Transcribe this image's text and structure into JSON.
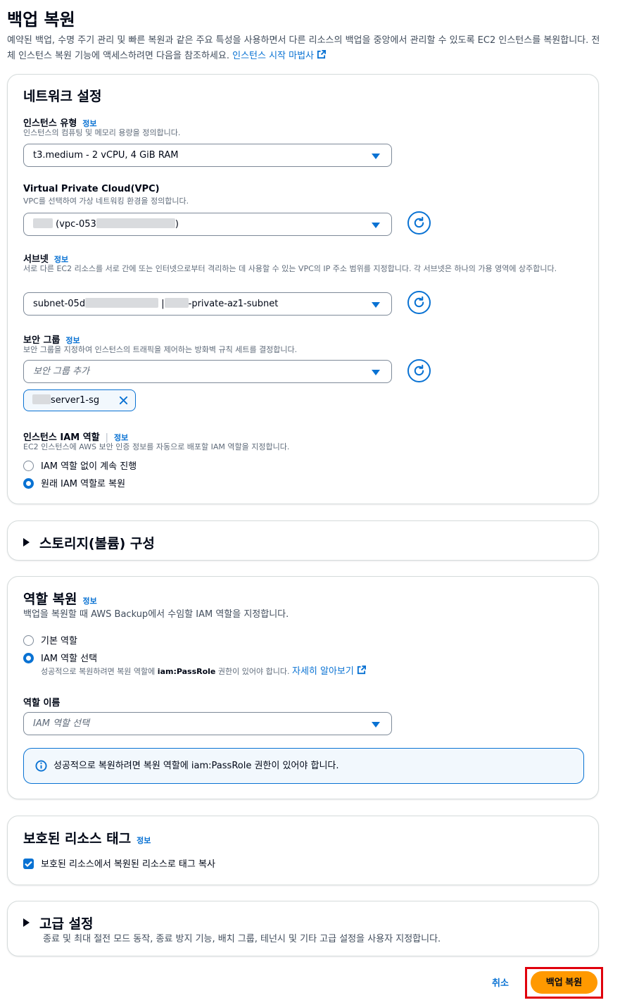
{
  "page": {
    "title": "백업 복원",
    "description": "예약된 백업, 수명 주기 관리 및 빠른 복원과 같은 주요 특성을 사용하면서 다른 리소스의 백업을 중앙에서 관리할 수 있도록 EC2 인스턴스를 복원합니다. 전체 인스턴스 복원 기능에 액세스하려면 다음을 참조하세요.",
    "description_link": "인스턴스 시작 마법사"
  },
  "network": {
    "heading": "네트워크 설정",
    "info": "정보",
    "instance_type": {
      "label": "인스턴스 유형",
      "desc": "인스턴스의 컴퓨팅 및 메모리 용량을 정의합니다.",
      "value": "t3.medium - 2 vCPU, 4 GiB RAM"
    },
    "vpc": {
      "label": "Virtual Private Cloud(VPC)",
      "desc": "VPC를 선택하여 가상 네트워킹 환경을 정의합니다.",
      "value_prefix": "(vpc-053",
      "value_suffix": ")"
    },
    "subnet": {
      "label": "서브넷",
      "desc": "서로 다른 EC2 리소스를 서로 간에 또는 인터넷으로부터 격리하는 데 사용할 수 있는 VPC의 IP 주소 범위를 지정합니다. 각 서브넷은 하나의 가용 영역에 상주합니다.",
      "value_prefix": "subnet-05d",
      "value_sep": "|",
      "value_suffix": "-private-az1-subnet"
    },
    "security_group": {
      "label": "보안 그룹",
      "desc": "보안 그룹을 지정하여 인스턴스의 트래픽을 제어하는 방화벽 규칙 세트를 결정합니다.",
      "placeholder": "보안 그룹 추가",
      "token": "server1-sg"
    },
    "iam_role": {
      "label": "인스턴스 IAM 역할",
      "desc": "EC2 인스턴스에 AWS 보안 인증 정보를 자동으로 배포할 IAM 역할을 지정합니다.",
      "options": [
        "IAM 역할 없이 계속 진행",
        "원래 IAM 역할로 복원"
      ],
      "selected": "원래 IAM 역할로 복원"
    }
  },
  "storage": {
    "heading": "스토리지(볼륨) 구성"
  },
  "restore_role": {
    "heading": "역할 복원",
    "info": "정보",
    "desc": "백업을 복원할 때 AWS Backup에서 수임할 IAM 역할을 지정합니다.",
    "options": [
      "기본 역할",
      "IAM 역할 선택"
    ],
    "selected": "IAM 역할 선택",
    "option_hint_pre": "성공적으로 복원하려면 복원 역할에",
    "option_hint_bold": "iam:PassRole",
    "option_hint_post": "권한이 있어야 합니다.",
    "option_hint_link": "자세히 알아보기",
    "role_name_label": "역할 이름",
    "role_name_placeholder": "IAM 역할 선택",
    "alert": "성공적으로 복원하려면 복원 역할에 iam:PassRole 권한이 있어야 합니다."
  },
  "tags": {
    "heading": "보호된 리소스 태그",
    "info": "정보",
    "checkbox_label": "보호된 리소스에서 복원된 리소스로 태그 복사",
    "checked": true
  },
  "advanced": {
    "heading": "고급 설정",
    "desc": "종료 및 최대 절전 모드 동작, 종료 방지 기능, 배치 그룹, 테넌시 및 기타 고급 설정을 사용자 지정합니다."
  },
  "footer": {
    "cancel": "취소",
    "submit": "백업 복원"
  },
  "colors": {
    "accent": "#0972d3",
    "primary_button": "#ff9900",
    "highlight": "#e0000c"
  }
}
